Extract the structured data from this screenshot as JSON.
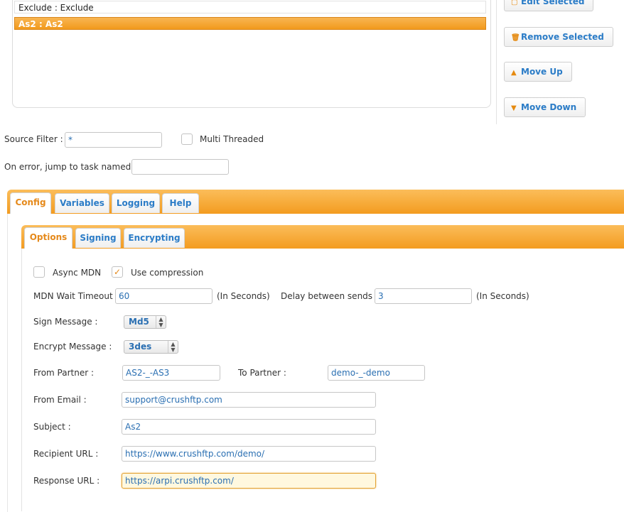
{
  "task_list": {
    "items": [
      {
        "label": "Exclude : Exclude",
        "selected": false
      },
      {
        "label": "As2 : As2",
        "selected": true
      }
    ]
  },
  "side_buttons": {
    "edit": "Edit Selected",
    "remove": "Remove Selected",
    "move_up": "Move Up",
    "move_down": "Move Down"
  },
  "source_filter": {
    "label": "Source Filter :",
    "value": "*"
  },
  "multi_threaded": {
    "label": "Multi Threaded",
    "checked": false
  },
  "on_error": {
    "label": "On error, jump to task named :",
    "value": ""
  },
  "main_tabs": [
    {
      "label": "Config",
      "active": true
    },
    {
      "label": "Variables",
      "active": false
    },
    {
      "label": "Logging",
      "active": false
    },
    {
      "label": "Help",
      "active": false
    }
  ],
  "sub_tabs": [
    {
      "label": "Options",
      "active": true
    },
    {
      "label": "Signing",
      "active": false
    },
    {
      "label": "Encrypting",
      "active": false
    }
  ],
  "options": {
    "async_mdn": {
      "label": "Async MDN",
      "checked": false
    },
    "use_compression": {
      "label": "Use compression",
      "checked": true
    },
    "mdn_wait_timeout": {
      "label": "MDN Wait Timeout :",
      "value": "60",
      "unit": "(In Seconds)"
    },
    "delay_between_sends": {
      "label": "Delay between sends :",
      "value": "3",
      "unit": "(In Seconds)"
    },
    "sign_message": {
      "label": "Sign Message :",
      "value": "Md5"
    },
    "encrypt_message": {
      "label": "Encrypt Message :",
      "value": "3des"
    },
    "from_partner": {
      "label": "From Partner :",
      "value": "AS2-_-AS3"
    },
    "to_partner": {
      "label": "To Partner :",
      "value": "demo-_-demo"
    },
    "from_email": {
      "label": "From Email :",
      "value": "support@crushftp.com"
    },
    "subject": {
      "label": "Subject :",
      "value": "As2"
    },
    "recipient_url": {
      "label": "Recipient URL :",
      "value": "https://www.crushftp.com/demo/"
    },
    "response_url": {
      "label": "Response URL :",
      "value": "https://arpi.crushftp.com/"
    }
  },
  "colors": {
    "accent": "#f39c20",
    "link": "#2b7cc7",
    "active_tab_text": "#e5891a"
  }
}
